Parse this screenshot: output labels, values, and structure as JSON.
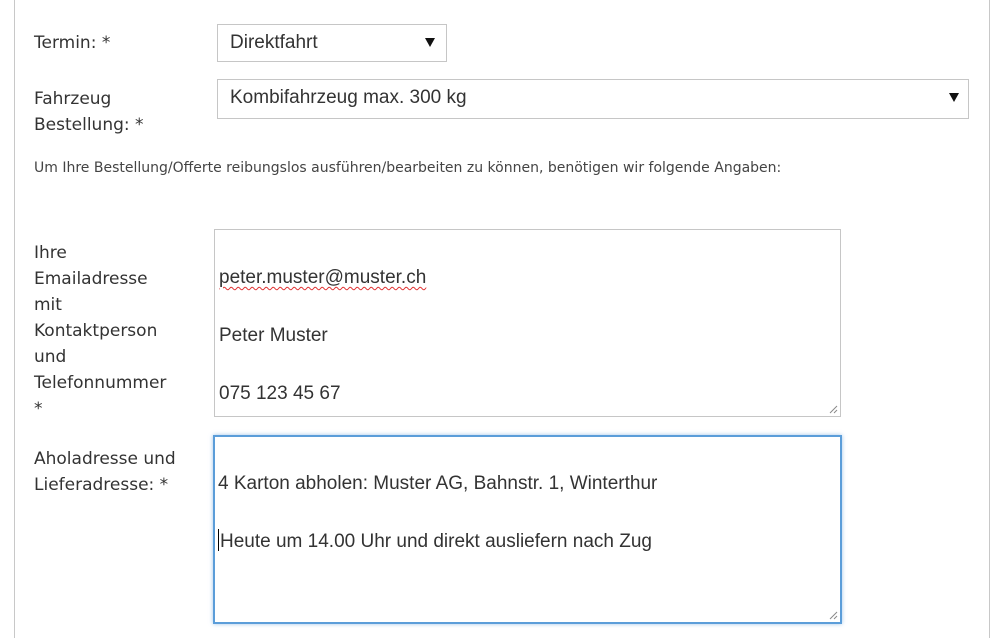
{
  "form": {
    "termin": {
      "label": "Termin: *",
      "selected": "Direktfahrt"
    },
    "fahrzeug": {
      "label": "Fahrzeug\nBestellung: *",
      "selected": "Kombifahrzeug max. 300 kg"
    },
    "info_text": "Um Ihre Bestellung/Offerte reibungslos ausführen/bearbeiten zu können, benötigen wir folgende Angaben:",
    "kontakt": {
      "label": "Ihre\nEmailadresse\nmit\nKontaktperson\nund\nTelefonnummer\n*",
      "lines": [
        "peter.muster@muster.ch",
        "Peter Muster",
        "075 123 45 67"
      ]
    },
    "adresse": {
      "label": "Aholadresse und\nLieferadresse: *",
      "lines": [
        "4 Karton abholen: Muster AG, Bahnstr. 1, Winterthur",
        "Heute um 14.00 Uhr und direkt ausliefern nach Zug"
      ]
    }
  },
  "colors": {
    "border": "#c6c6c6",
    "focus_border": "#5b9dd9",
    "text": "#333333",
    "spellcheck": "#e03030"
  },
  "icons": {
    "dropdown": "triangle-down-icon",
    "resize": "resize-grip-icon"
  }
}
